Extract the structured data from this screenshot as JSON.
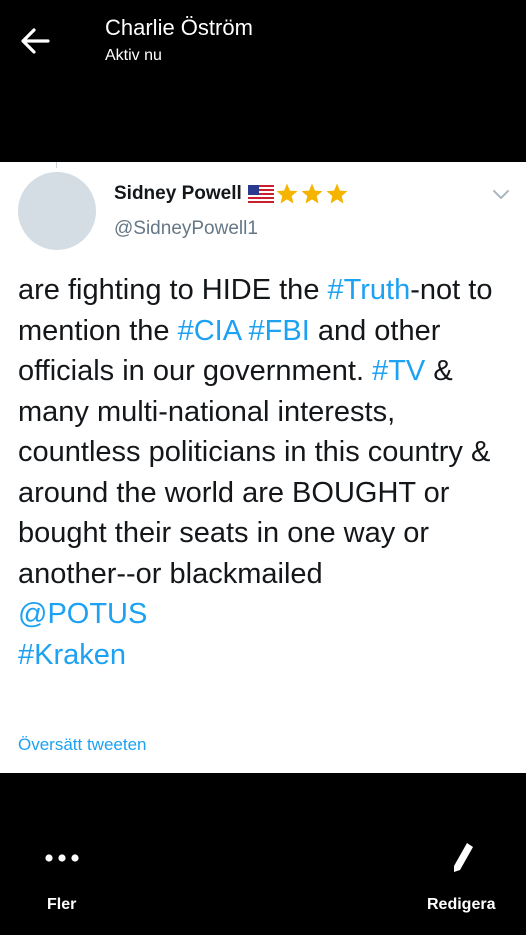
{
  "header": {
    "contact_name": "Charlie Öström",
    "status": "Aktiv nu"
  },
  "tweet": {
    "author_name": "Sidney Powell",
    "author_handle": "@SidneyPowell1",
    "text_segments": [
      {
        "text": "are fighting to HIDE the ",
        "link": false
      },
      {
        "text": "#Truth",
        "link": true
      },
      {
        "text": "-not to mention the ",
        "link": false
      },
      {
        "text": "#CIA",
        "link": true
      },
      {
        "text": " ",
        "link": false
      },
      {
        "text": "#FBI",
        "link": true
      },
      {
        "text": " and other officials in our government. ",
        "link": false
      },
      {
        "text": "#TV",
        "link": true
      },
      {
        "text": " & many multi-national interests, countless politicians in this country & around the world are BOUGHT or bought their seats in one way or another--or blackmailed",
        "link": false
      }
    ],
    "mention": "@POTUS",
    "hashtag": "#Kraken",
    "translate_label": "Översätt tweeten"
  },
  "bottom": {
    "more_label": "Fler",
    "edit_label": "Redigera"
  },
  "colors": {
    "link": "#1da1f2",
    "star": "#f5b400"
  }
}
